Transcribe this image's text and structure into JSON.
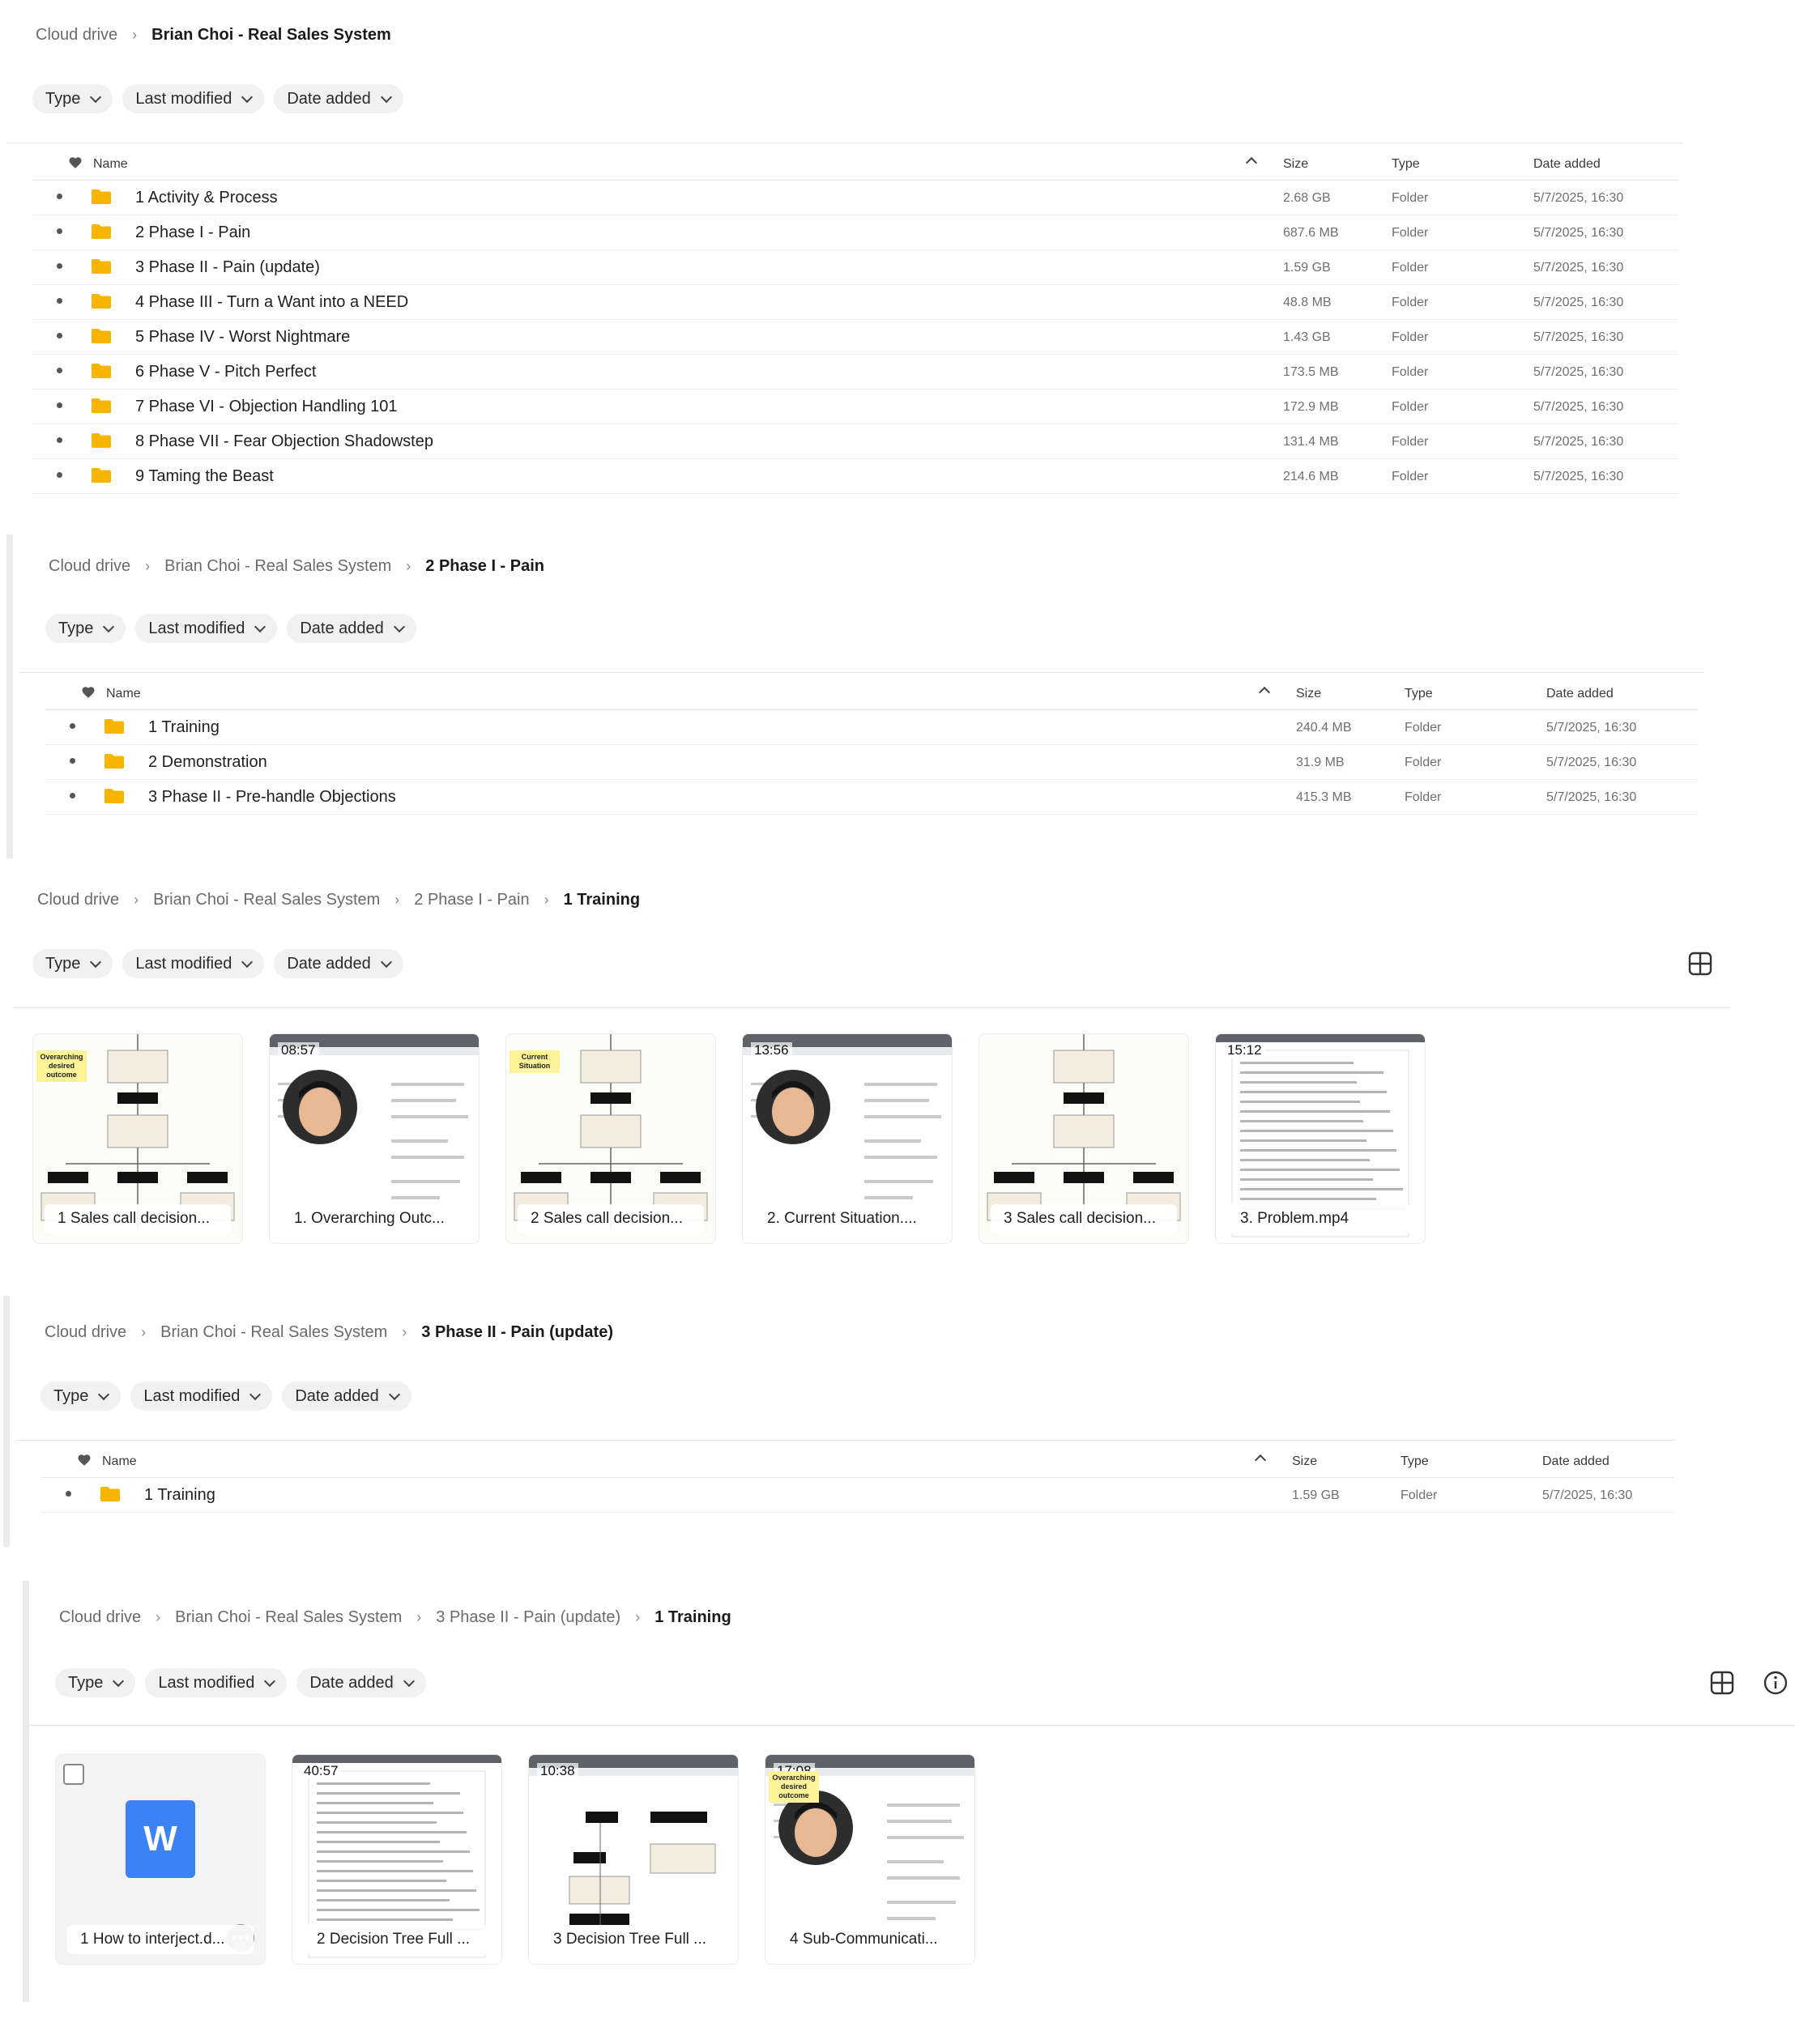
{
  "panel1": {
    "breadcrumb": [
      "Cloud drive",
      "Brian Choi - Real Sales System"
    ],
    "filters": [
      "Type",
      "Last modified",
      "Date added"
    ],
    "columns": {
      "name": "Name",
      "size": "Size",
      "type": "Type",
      "date": "Date added"
    },
    "rows": [
      {
        "name": "1 Activity & Process",
        "size": "2.68 GB",
        "type": "Folder",
        "date": "5/7/2025, 16:30"
      },
      {
        "name": "2 Phase I - Pain",
        "size": "687.6 MB",
        "type": "Folder",
        "date": "5/7/2025, 16:30"
      },
      {
        "name": "3 Phase II - Pain (update)",
        "size": "1.59 GB",
        "type": "Folder",
        "date": "5/7/2025, 16:30"
      },
      {
        "name": "4 Phase III - Turn a Want into a NEED",
        "size": "48.8 MB",
        "type": "Folder",
        "date": "5/7/2025, 16:30"
      },
      {
        "name": "5 Phase IV - Worst Nightmare",
        "size": "1.43 GB",
        "type": "Folder",
        "date": "5/7/2025, 16:30"
      },
      {
        "name": "6 Phase V - Pitch Perfect",
        "size": "173.5 MB",
        "type": "Folder",
        "date": "5/7/2025, 16:30"
      },
      {
        "name": "7 Phase VI - Objection Handling 101",
        "size": "172.9 MB",
        "type": "Folder",
        "date": "5/7/2025, 16:30"
      },
      {
        "name": "8 Phase VII - Fear Objection Shadowstep",
        "size": "131.4 MB",
        "type": "Folder",
        "date": "5/7/2025, 16:30"
      },
      {
        "name": "9 Taming the Beast",
        "size": "214.6 MB",
        "type": "Folder",
        "date": "5/7/2025, 16:30"
      }
    ]
  },
  "panel2": {
    "breadcrumb": [
      "Cloud drive",
      "Brian Choi - Real Sales System",
      "2 Phase I - Pain"
    ],
    "filters": [
      "Type",
      "Last modified",
      "Date added"
    ],
    "columns": {
      "name": "Name",
      "size": "Size",
      "type": "Type",
      "date": "Date added"
    },
    "rows": [
      {
        "name": "1 Training",
        "size": "240.4 MB",
        "type": "Folder",
        "date": "5/7/2025, 16:30"
      },
      {
        "name": "2 Demonstration",
        "size": "31.9 MB",
        "type": "Folder",
        "date": "5/7/2025, 16:30"
      },
      {
        "name": "3 Phase II - Pre-handle Objections",
        "size": "415.3 MB",
        "type": "Folder",
        "date": "5/7/2025, 16:30"
      }
    ]
  },
  "panel3": {
    "breadcrumb": [
      "Cloud drive",
      "Brian Choi - Real Sales System",
      "2 Phase I - Pain",
      "1 Training"
    ],
    "filters": [
      "Type",
      "Last modified",
      "Date added"
    ],
    "cards": [
      {
        "label": "1 Sales call decision...",
        "duration": "",
        "kind": "flow",
        "tag": "Overarching desired outcome"
      },
      {
        "label": "1. Overarching Outc...",
        "duration": "08:57",
        "kind": "video-face",
        "tag": ""
      },
      {
        "label": "2 Sales call decision...",
        "duration": "",
        "kind": "flow",
        "tag": "Current Situation"
      },
      {
        "label": "2. Current Situation....",
        "duration": "13:56",
        "kind": "video-face",
        "tag": ""
      },
      {
        "label": "3 Sales call decision...",
        "duration": "",
        "kind": "flow",
        "tag": ""
      },
      {
        "label": "3. Problem.mp4",
        "duration": "15:12",
        "kind": "video-doc",
        "tag": ""
      }
    ]
  },
  "panel4": {
    "breadcrumb": [
      "Cloud drive",
      "Brian Choi - Real Sales System",
      "3 Phase II - Pain (update)"
    ],
    "filters": [
      "Type",
      "Last modified",
      "Date added"
    ],
    "columns": {
      "name": "Name",
      "size": "Size",
      "type": "Type",
      "date": "Date added"
    },
    "rows": [
      {
        "name": "1 Training",
        "size": "1.59 GB",
        "type": "Folder",
        "date": "5/7/2025, 16:30"
      }
    ]
  },
  "panel5": {
    "breadcrumb": [
      "Cloud drive",
      "Brian Choi - Real Sales System",
      "3 Phase II - Pain (update)",
      "1 Training"
    ],
    "filters": [
      "Type",
      "Last modified",
      "Date added"
    ],
    "cards": [
      {
        "label": "1 How to interject.d...",
        "duration": "",
        "kind": "word",
        "tag": "W"
      },
      {
        "label": "2 Decision Tree Full ...",
        "duration": "40:57",
        "kind": "video-doc",
        "tag": ""
      },
      {
        "label": "3 Decision Tree Full ...",
        "duration": "10:38",
        "kind": "video-flow",
        "tag": ""
      },
      {
        "label": "4 Sub-Communicati...",
        "duration": "17:08",
        "kind": "video-face",
        "tag": "Overarching desired outcome"
      }
    ]
  },
  "colors": {
    "folder": "#f7b500",
    "word": "#3b82f6",
    "accent": "#1a1a1a"
  }
}
